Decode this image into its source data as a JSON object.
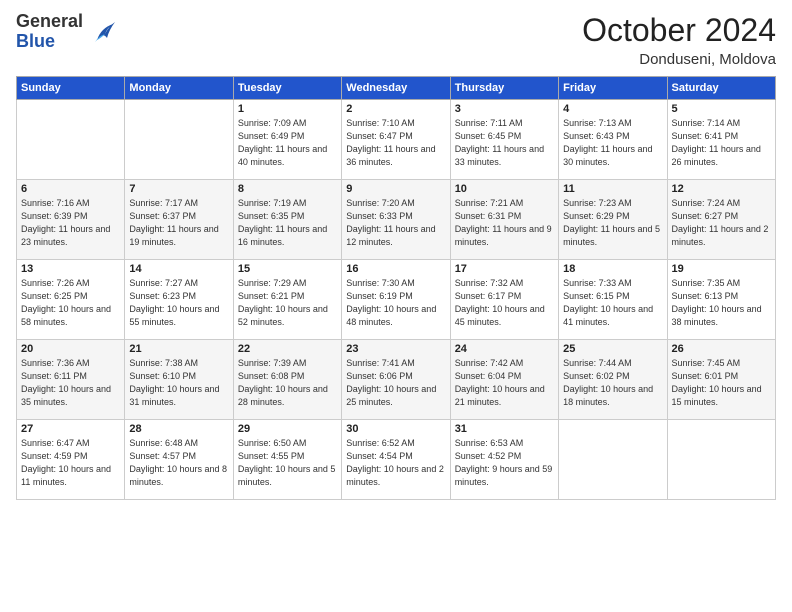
{
  "logo": {
    "general": "General",
    "blue": "Blue"
  },
  "header": {
    "month": "October 2024",
    "location": "Donduseni, Moldova"
  },
  "weekdays": [
    "Sunday",
    "Monday",
    "Tuesday",
    "Wednesday",
    "Thursday",
    "Friday",
    "Saturday"
  ],
  "weeks": [
    [
      {
        "day": "",
        "info": ""
      },
      {
        "day": "",
        "info": ""
      },
      {
        "day": "1",
        "info": "Sunrise: 7:09 AM\nSunset: 6:49 PM\nDaylight: 11 hours and 40 minutes."
      },
      {
        "day": "2",
        "info": "Sunrise: 7:10 AM\nSunset: 6:47 PM\nDaylight: 11 hours and 36 minutes."
      },
      {
        "day": "3",
        "info": "Sunrise: 7:11 AM\nSunset: 6:45 PM\nDaylight: 11 hours and 33 minutes."
      },
      {
        "day": "4",
        "info": "Sunrise: 7:13 AM\nSunset: 6:43 PM\nDaylight: 11 hours and 30 minutes."
      },
      {
        "day": "5",
        "info": "Sunrise: 7:14 AM\nSunset: 6:41 PM\nDaylight: 11 hours and 26 minutes."
      }
    ],
    [
      {
        "day": "6",
        "info": "Sunrise: 7:16 AM\nSunset: 6:39 PM\nDaylight: 11 hours and 23 minutes."
      },
      {
        "day": "7",
        "info": "Sunrise: 7:17 AM\nSunset: 6:37 PM\nDaylight: 11 hours and 19 minutes."
      },
      {
        "day": "8",
        "info": "Sunrise: 7:19 AM\nSunset: 6:35 PM\nDaylight: 11 hours and 16 minutes."
      },
      {
        "day": "9",
        "info": "Sunrise: 7:20 AM\nSunset: 6:33 PM\nDaylight: 11 hours and 12 minutes."
      },
      {
        "day": "10",
        "info": "Sunrise: 7:21 AM\nSunset: 6:31 PM\nDaylight: 11 hours and 9 minutes."
      },
      {
        "day": "11",
        "info": "Sunrise: 7:23 AM\nSunset: 6:29 PM\nDaylight: 11 hours and 5 minutes."
      },
      {
        "day": "12",
        "info": "Sunrise: 7:24 AM\nSunset: 6:27 PM\nDaylight: 11 hours and 2 minutes."
      }
    ],
    [
      {
        "day": "13",
        "info": "Sunrise: 7:26 AM\nSunset: 6:25 PM\nDaylight: 10 hours and 58 minutes."
      },
      {
        "day": "14",
        "info": "Sunrise: 7:27 AM\nSunset: 6:23 PM\nDaylight: 10 hours and 55 minutes."
      },
      {
        "day": "15",
        "info": "Sunrise: 7:29 AM\nSunset: 6:21 PM\nDaylight: 10 hours and 52 minutes."
      },
      {
        "day": "16",
        "info": "Sunrise: 7:30 AM\nSunset: 6:19 PM\nDaylight: 10 hours and 48 minutes."
      },
      {
        "day": "17",
        "info": "Sunrise: 7:32 AM\nSunset: 6:17 PM\nDaylight: 10 hours and 45 minutes."
      },
      {
        "day": "18",
        "info": "Sunrise: 7:33 AM\nSunset: 6:15 PM\nDaylight: 10 hours and 41 minutes."
      },
      {
        "day": "19",
        "info": "Sunrise: 7:35 AM\nSunset: 6:13 PM\nDaylight: 10 hours and 38 minutes."
      }
    ],
    [
      {
        "day": "20",
        "info": "Sunrise: 7:36 AM\nSunset: 6:11 PM\nDaylight: 10 hours and 35 minutes."
      },
      {
        "day": "21",
        "info": "Sunrise: 7:38 AM\nSunset: 6:10 PM\nDaylight: 10 hours and 31 minutes."
      },
      {
        "day": "22",
        "info": "Sunrise: 7:39 AM\nSunset: 6:08 PM\nDaylight: 10 hours and 28 minutes."
      },
      {
        "day": "23",
        "info": "Sunrise: 7:41 AM\nSunset: 6:06 PM\nDaylight: 10 hours and 25 minutes."
      },
      {
        "day": "24",
        "info": "Sunrise: 7:42 AM\nSunset: 6:04 PM\nDaylight: 10 hours and 21 minutes."
      },
      {
        "day": "25",
        "info": "Sunrise: 7:44 AM\nSunset: 6:02 PM\nDaylight: 10 hours and 18 minutes."
      },
      {
        "day": "26",
        "info": "Sunrise: 7:45 AM\nSunset: 6:01 PM\nDaylight: 10 hours and 15 minutes."
      }
    ],
    [
      {
        "day": "27",
        "info": "Sunrise: 6:47 AM\nSunset: 4:59 PM\nDaylight: 10 hours and 11 minutes."
      },
      {
        "day": "28",
        "info": "Sunrise: 6:48 AM\nSunset: 4:57 PM\nDaylight: 10 hours and 8 minutes."
      },
      {
        "day": "29",
        "info": "Sunrise: 6:50 AM\nSunset: 4:55 PM\nDaylight: 10 hours and 5 minutes."
      },
      {
        "day": "30",
        "info": "Sunrise: 6:52 AM\nSunset: 4:54 PM\nDaylight: 10 hours and 2 minutes."
      },
      {
        "day": "31",
        "info": "Sunrise: 6:53 AM\nSunset: 4:52 PM\nDaylight: 9 hours and 59 minutes."
      },
      {
        "day": "",
        "info": ""
      },
      {
        "day": "",
        "info": ""
      }
    ]
  ]
}
